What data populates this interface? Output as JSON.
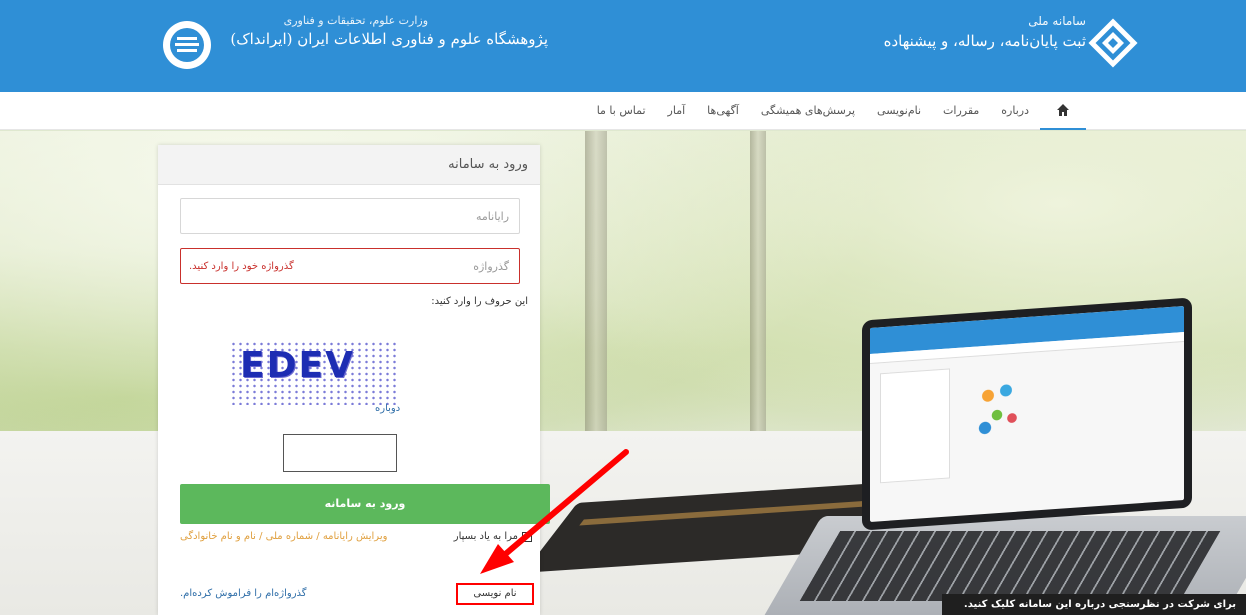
{
  "header": {
    "system_line1": "سامانه ملی",
    "system_line2": "ثبت پایان‌نامه، رساله، و پیشنهاده",
    "ministry": "وزارت علوم، تحقیقات و فناوری",
    "institute": "پژوهشگاه علوم و فناوری اطلاعات ایران (ایرانداک)",
    "colors": {
      "primary": "#2f8fd6"
    }
  },
  "nav": {
    "home_icon": "home-icon",
    "items": [
      "درباره",
      "مقررات",
      "نام‌نویسی",
      "پرسش‌های همیشگی",
      "آگهی‌ها",
      "آمار",
      "تماس با ما"
    ]
  },
  "login": {
    "title": "ورود به سامانه",
    "username_placeholder": "رایانامه",
    "password_placeholder": "گذرواژه",
    "password_error": "گذرواژه خود را وارد کنید.",
    "captcha_label": "این حروف را وارد کنید:",
    "captcha_text": "EDEV",
    "refresh_label": "دوباره",
    "submit_label": "ورود به سامانه",
    "remember_label": "مرا به یاد بسپار",
    "edit_link": "ویرایش رایانامه / شماره ملی / نام و نام خانوادگی",
    "register_label": "نام نویسی",
    "forgot_label": "گذرواژه‌ام را فراموش کرده‌ام."
  },
  "survey": {
    "text": "برای شرکت در نظرسنجی درباره این سامانه کلیک کنید."
  }
}
